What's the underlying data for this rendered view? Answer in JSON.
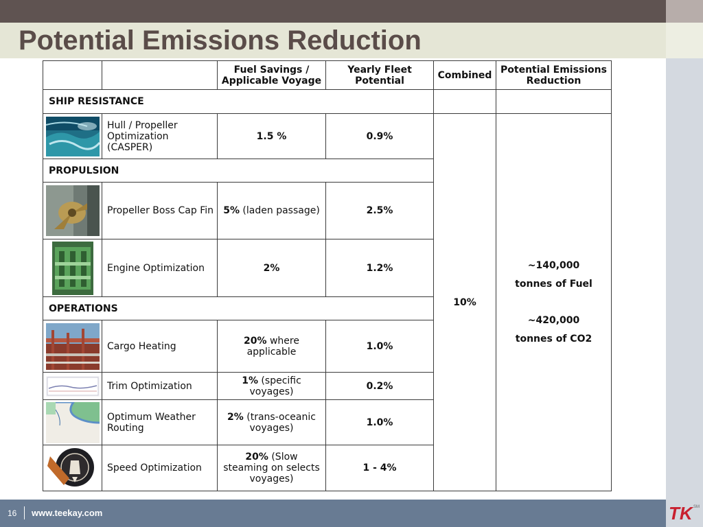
{
  "slide": {
    "title": "Potential Emissions Reduction",
    "page_number": "16",
    "website": "www.teekay.com",
    "logo_text": "TK",
    "logo_mark": "SM",
    "colors": {
      "top_bar": "#5f5351",
      "title_band": "#e5e6d6",
      "footer_bar": "#687b93",
      "title_text": "#5a4c49",
      "logo_red": "#c8202f"
    }
  },
  "table": {
    "headers": {
      "fuel_savings": "Fuel Savings / Applicable Voyage",
      "yearly_fleet": "Yearly Fleet Potential",
      "combined": "Combined",
      "potential": "Potential Emissions Reduction"
    },
    "sections": {
      "ship_resistance": "SHIP RESISTANCE",
      "propulsion": "PROPULSION",
      "operations": "OPERATIONS"
    },
    "rows": [
      {
        "name": "Hull / Propeller Optimization (CASPER)",
        "fuel_bold": "1.5 %",
        "fuel_rest": "",
        "yearly": "0.9%",
        "icon": "hull-propeller-image"
      },
      {
        "name": "Propeller Boss Cap Fin",
        "fuel_bold": "5%",
        "fuel_rest": " (laden passage)",
        "yearly": "2.5%",
        "icon": "propeller-image"
      },
      {
        "name": "Engine Optimization",
        "fuel_bold": "2%",
        "fuel_rest": "",
        "yearly": "1.2%",
        "icon": "engine-image"
      },
      {
        "name": "Cargo Heating",
        "fuel_bold": "20%",
        "fuel_rest": " where applicable",
        "yearly": "1.0%",
        "icon": "cargo-deck-image"
      },
      {
        "name": "Trim Optimization",
        "fuel_bold": "1%",
        "fuel_rest": " (specific voyages)",
        "yearly": "0.2%",
        "icon": "trim-chart-image"
      },
      {
        "name": "Optimum Weather Routing",
        "fuel_bold": "2%",
        "fuel_rest": " (trans-oceanic voyages)",
        "yearly": "1.0%",
        "icon": "weather-map-image"
      },
      {
        "name": "Speed Optimization",
        "fuel_bold": "20%",
        "fuel_rest": " (Slow steaming on selects voyages)",
        "yearly": "1 - 4%",
        "icon": "slow-steaming-badge-image"
      }
    ],
    "combined_value": "10%",
    "potential": {
      "fuel_amount": "~140,000",
      "fuel_unit": "tonnes of Fuel",
      "co2_amount": "~420,000",
      "co2_unit": "tonnes of CO2"
    }
  }
}
